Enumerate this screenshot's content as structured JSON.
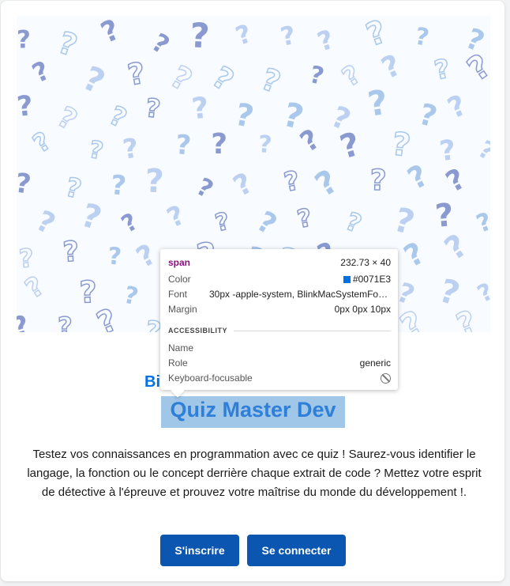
{
  "hero": {
    "pattern_glyph": "?",
    "colors": [
      "#8a9ad1",
      "#a9c8ec",
      "#bcd0f2"
    ]
  },
  "welcome_prefix": "Bi",
  "title": "Quiz Master Dev",
  "description": "Testez vos connaissances en programmation avec ce quiz ! Saurez-vous identifier le langage, la fonction ou le concept derrière chaque extrait de code ? Mettez votre esprit de détective à l'épreuve et prouvez votre maîtrise du monde du développement !.",
  "buttons": {
    "signup": "S'inscrire",
    "login": "Se connecter"
  },
  "inspector": {
    "tag": "span",
    "size": "232.73 × 40",
    "rows": {
      "color_label": "Color",
      "color_value": "#0071E3",
      "font_label": "Font",
      "font_value": "30px -apple-system, BlinkMacSystemFon...",
      "margin_label": "Margin",
      "margin_value": "0px 0px 10px"
    },
    "accessibility": {
      "section_label": "ACCESSIBILITY",
      "name_label": "Name",
      "name_value": "",
      "role_label": "Role",
      "role_value": "generic",
      "focus_label": "Keyboard-focusable",
      "focus_icon": "not-allowed-icon"
    }
  },
  "colors": {
    "accent": "#0071e3",
    "button_bg": "#0a56b1"
  }
}
